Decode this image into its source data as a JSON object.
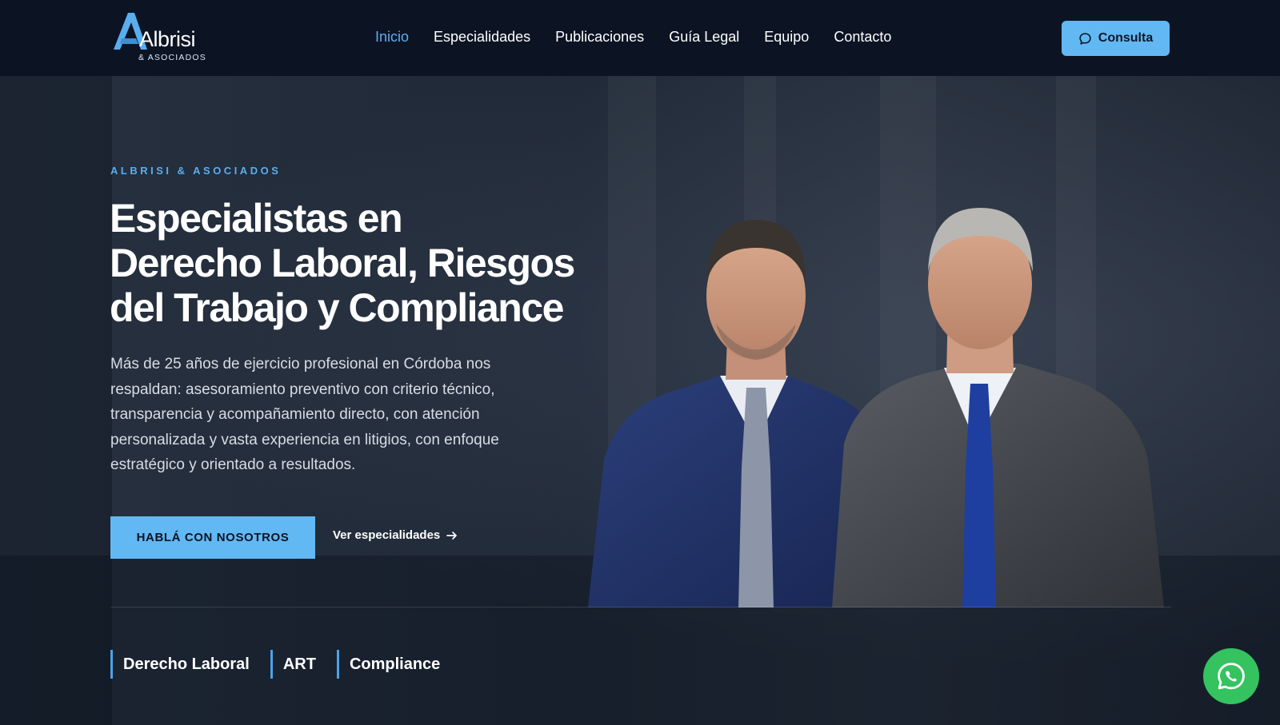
{
  "brand": {
    "name": "Albrisi",
    "sub": "& ASOCIADOS",
    "accent": "#5aaef0",
    "button_color": "#62b8f3",
    "header_bg": "#0c1424"
  },
  "nav": {
    "items": [
      {
        "label": "Inicio",
        "active": true
      },
      {
        "label": "Especialidades",
        "active": false
      },
      {
        "label": "Publicaciones",
        "active": false
      },
      {
        "label": "Guía Legal",
        "active": false
      },
      {
        "label": "Equipo",
        "active": false
      },
      {
        "label": "Contacto",
        "active": false
      }
    ],
    "cta": {
      "label": "Consulta",
      "icon": "chat-bubble-icon"
    }
  },
  "hero": {
    "eyebrow": "ALBRISI & ASOCIADOS",
    "title_lines": [
      "Especialistas en",
      "Derecho Laboral, Riesgos",
      "del Trabajo y Compliance"
    ],
    "description": "Más de 25 años de ejercicio profesional en Córdoba nos respaldan: asesoramiento preventivo con criterio técnico, transparencia y acompañamiento directo, con atención personalizada y vasta experiencia en litigios, con enfoque estratégico y orientado a resultados.",
    "cta_primary": "HABLÁ CON NOSOTROS",
    "cta_secondary": "Ver especialidades",
    "cta_secondary_icon": "arrow-right-icon",
    "tags": [
      "Derecho Laboral",
      "ART",
      "Compliance"
    ]
  },
  "floating": {
    "whatsapp_icon": "whatsapp-icon",
    "whatsapp_color": "#34c35f"
  }
}
